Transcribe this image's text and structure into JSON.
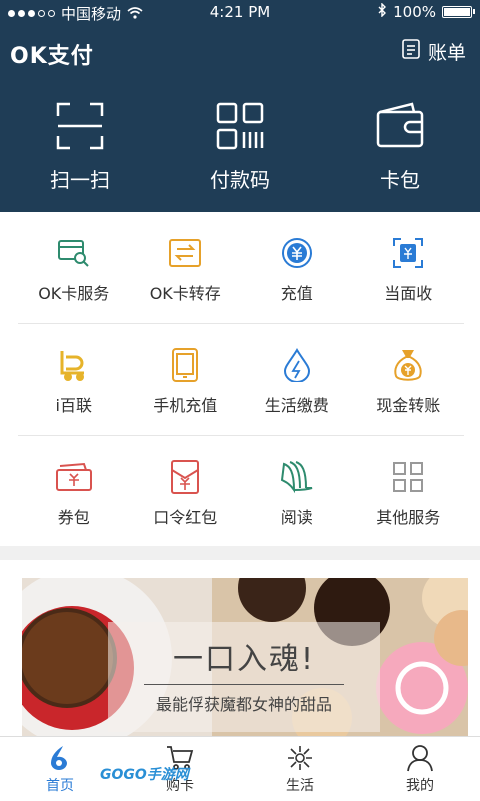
{
  "status_bar": {
    "carrier": "中国移动",
    "time": "4:21 PM",
    "battery": "100%"
  },
  "header": {
    "title": "OK支付",
    "bill_label": "账单",
    "actions": [
      {
        "label": "扫一扫",
        "icon": "scan-icon"
      },
      {
        "label": "付款码",
        "icon": "qr-code-icon"
      },
      {
        "label": "卡包",
        "icon": "wallet-icon"
      }
    ]
  },
  "services": [
    {
      "label": "OK卡服务",
      "icon": "card-search-icon",
      "color": "#2e8b6e"
    },
    {
      "label": "OK卡转存",
      "icon": "card-transfer-icon",
      "color": "#e6a12a"
    },
    {
      "label": "充值",
      "icon": "yuan-circle-icon",
      "color": "#2a7bd5"
    },
    {
      "label": "当面收",
      "icon": "scan-yuan-icon",
      "color": "#2a7bd5"
    },
    {
      "label": "i百联",
      "icon": "cart-b-icon",
      "color": "#e6b32a"
    },
    {
      "label": "手机充值",
      "icon": "phone-icon",
      "color": "#e6a12a"
    },
    {
      "label": "生活缴费",
      "icon": "water-bolt-icon",
      "color": "#2a7bd5"
    },
    {
      "label": "现金转账",
      "icon": "money-bag-icon",
      "color": "#e6a12a"
    },
    {
      "label": "券包",
      "icon": "coupon-icon",
      "color": "#d9534f"
    },
    {
      "label": "口令红包",
      "icon": "red-envelope-icon",
      "color": "#d9534f"
    },
    {
      "label": "阅读",
      "icon": "book-icon",
      "color": "#2e8b6e"
    },
    {
      "label": "其他服务",
      "icon": "grid-icon",
      "color": "#999999"
    }
  ],
  "banner": {
    "headline": "一口入魂!",
    "subline": "最能俘获魔都女神的甜品"
  },
  "bottom_nav": [
    {
      "label": "首页",
      "icon": "home-icon"
    },
    {
      "label": "购卡",
      "icon": "cart-icon"
    },
    {
      "label": "生活",
      "icon": "life-icon"
    },
    {
      "label": "我的",
      "icon": "profile-icon"
    }
  ],
  "watermark": "GOGO手游网",
  "colors": {
    "header_bg": "#1f3d56",
    "accent_blue": "#2a7bd5"
  }
}
